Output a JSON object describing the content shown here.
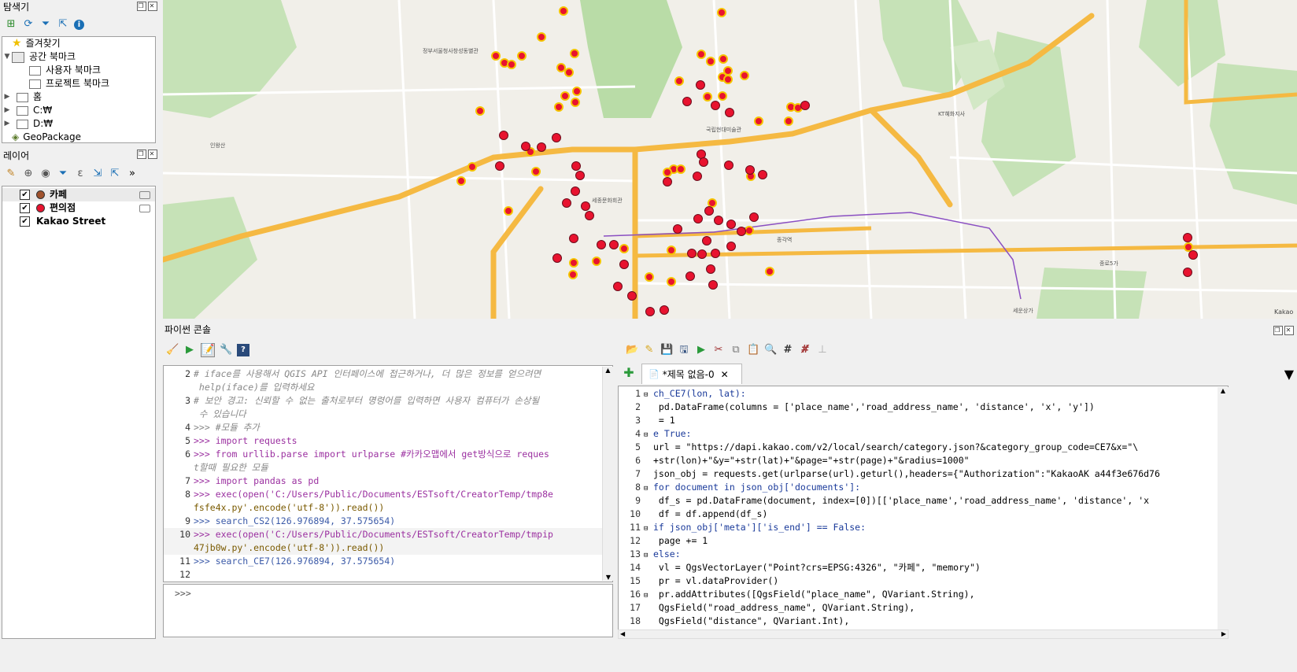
{
  "browser": {
    "title": "탐색기",
    "items": [
      {
        "label": "즐겨찾기",
        "icon": "star-icon"
      },
      {
        "label": "공간 북마크",
        "icon": "bookmark-icon"
      },
      {
        "label": "사용자 북마크",
        "icon": "folder-icon"
      },
      {
        "label": "프로젝트 북마크",
        "icon": "folder-icon"
      },
      {
        "label": "홈",
        "icon": "folder-icon"
      },
      {
        "label": "C:₩",
        "icon": "folder-icon"
      },
      {
        "label": "D:₩",
        "icon": "folder-icon"
      },
      {
        "label": "GeoPackage",
        "icon": "geopackage-icon"
      }
    ]
  },
  "layers": {
    "title": "레이어",
    "items": [
      {
        "label": "카페",
        "checked": true,
        "symbol": "#a0522d"
      },
      {
        "label": "편의점",
        "checked": true,
        "symbol": "#e8132f"
      },
      {
        "label": "Kakao Street",
        "checked": true
      }
    ]
  },
  "python_console": {
    "title": "파이썬 콘솔",
    "prompt": ">>>",
    "lines": [
      {
        "n": "2",
        "text": "# iface를 사용해서 QGIS API 인터페이스에 접근하거나, 더 많은 정보를 얻으려면 help(iface)를 입력하세요",
        "type": "comment"
      },
      {
        "n": "",
        "text": "",
        "type": "comment"
      },
      {
        "n": "3",
        "text": "# 보안 경고: 신뢰할 수 없는 출처로부터 명령어를 입력하면 사용자 컴퓨터가 손상될 수 있습니다",
        "type": "comment"
      },
      {
        "n": "",
        "text": "",
        "type": "comment"
      },
      {
        "n": "4",
        "text": ">>> #모듈 추가",
        "type": "code"
      },
      {
        "n": "5",
        "text": ">>> import requests",
        "type": "code"
      },
      {
        "n": "6",
        "text": ">>> from urllib.parse import urlparse #카카오맵에서 get방식으로 request할때 필요한 모듈",
        "type": "code"
      },
      {
        "n": "",
        "text": "",
        "type": "code"
      },
      {
        "n": "7",
        "text": ">>> import pandas as pd",
        "type": "code"
      },
      {
        "n": "8",
        "text": ">>> exec(open('C:/Users/Public/Documents/ESTsoft/CreatorTemp/tmp8efsfe4x.py'.encode('utf-8')).read())",
        "type": "code"
      },
      {
        "n": "",
        "text": "",
        "type": "code"
      },
      {
        "n": "9",
        "text": ">>> search_CS2(126.976894, 37.575654)",
        "type": "code"
      },
      {
        "n": "10",
        "text": ">>> exec(open('C:/Users/Public/Documents/ESTsoft/CreatorTemp/tmpip47jb0w.py'.encode('utf-8')).read())",
        "type": "code"
      },
      {
        "n": "",
        "text": "",
        "type": "code"
      },
      {
        "n": "11",
        "text": ">>> search_CE7(126.976894, 37.575654)",
        "type": "code"
      },
      {
        "n": "12",
        "text": "",
        "type": "code"
      }
    ],
    "display_lines": [
      {
        "n": "2",
        "text": "# iface를 사용해서 QGIS API 인터페이스에 접근하거나, 더 많은 정보를 얻으려면",
        "cls": "cm"
      },
      {
        "n": "",
        "text": " help(iface)를 입력하세요",
        "cls": "cm"
      },
      {
        "n": "3",
        "text": "# 보안 경고: 신뢰할 수 없는 출처로부터 명령어를 입력하면 사용자 컴퓨터가 손상될",
        "cls": "cm"
      },
      {
        "n": "",
        "text": " 수 있습니다",
        "cls": "cm"
      },
      {
        "n": "4",
        "text": ">>> #모듈 추가",
        "cls": "cm"
      },
      {
        "n": "5",
        "text": ">>> import requests",
        "cls": "kw"
      },
      {
        "n": "6",
        "text": ">>> from urllib.parse import urlparse #카카오맵에서 get방식으로 reques",
        "cls": "kw"
      },
      {
        "n": "",
        "text": "t할때 필요한 모듈",
        "cls": "cm"
      },
      {
        "n": "7",
        "text": ">>> import pandas as pd",
        "cls": "kw"
      },
      {
        "n": "8",
        "text": ">>> exec(open('C:/Users/Public/Documents/ESTsoft/CreatorTemp/tmp8e",
        "cls": "kw"
      },
      {
        "n": "",
        "text": "fsfe4x.py'.encode('utf-8')).read())",
        "cls": "st"
      },
      {
        "n": "9",
        "text": ">>> search_CS2(126.976894, 37.575654)",
        "cls": "pr"
      },
      {
        "n": "10",
        "text": ">>> exec(open('C:/Users/Public/Documents/ESTsoft/CreatorTemp/tmpip",
        "cls": "kw"
      },
      {
        "n": "",
        "text": "47jb0w.py'.encode('utf-8')).read())",
        "cls": "st"
      },
      {
        "n": "11",
        "text": ">>> search_CE7(126.976894, 37.575654)",
        "cls": "pr"
      },
      {
        "n": "12",
        "text": "",
        "cls": "pr"
      }
    ]
  },
  "editor": {
    "tab_label": "*제목 없음-0",
    "lines": [
      {
        "n": "1",
        "text": "ch_CE7(lon, lat):",
        "fold": true
      },
      {
        "n": "2",
        "text": " pd.DataFrame(columns = ['place_name','road_address_name', 'distance', 'x', 'y'])",
        "fold": false
      },
      {
        "n": "3",
        "text": " = 1",
        "fold": false
      },
      {
        "n": "4",
        "text": "e True:",
        "fold": true
      },
      {
        "n": "5",
        "text": "url = \"https://dapi.kakao.com/v2/local/search/category.json?&category_group_code=CE7&x=\"\\",
        "fold": false
      },
      {
        "n": "6",
        "text": "+str(lon)+\"&y=\"+str(lat)+\"&page=\"+str(page)+\"&radius=1000\"",
        "fold": false
      },
      {
        "n": "7",
        "text": "json_obj = requests.get(urlparse(url).geturl(),headers={\"Authorization\":\"KakaoAK a44f3e676d76",
        "fold": false
      },
      {
        "n": "8",
        "text": "for document in json_obj['documents']:",
        "fold": true
      },
      {
        "n": "9",
        "text": "    df_s = pd.DataFrame(document, index=[0])[['place_name','road_address_name', 'distance', 'x",
        "fold": false
      },
      {
        "n": "10",
        "text": "    df = df.append(df_s)",
        "fold": false
      },
      {
        "n": "11",
        "text": "if json_obj['meta']['is_end'] == False:",
        "fold": true
      },
      {
        "n": "12",
        "text": "    page += 1",
        "fold": false
      },
      {
        "n": "13",
        "text": "else:",
        "fold": true
      },
      {
        "n": "14",
        "text": "    vl = QgsVectorLayer(\"Point?crs=EPSG:4326\", \"카페\", \"memory\")",
        "fold": false
      },
      {
        "n": "15",
        "text": "    pr = vl.dataProvider()",
        "fold": false
      },
      {
        "n": "16",
        "text": "    pr.addAttributes([QgsField(\"place_name\", QVariant.String),",
        "fold": true
      },
      {
        "n": "17",
        "text": "                      QgsField(\"road_address_name\", QVariant.String),",
        "fold": false
      },
      {
        "n": "18",
        "text": "                      QgsField(\"distance\",  QVariant.Int),",
        "fold": false
      }
    ]
  },
  "map": {
    "attribution": "Kakao"
  }
}
